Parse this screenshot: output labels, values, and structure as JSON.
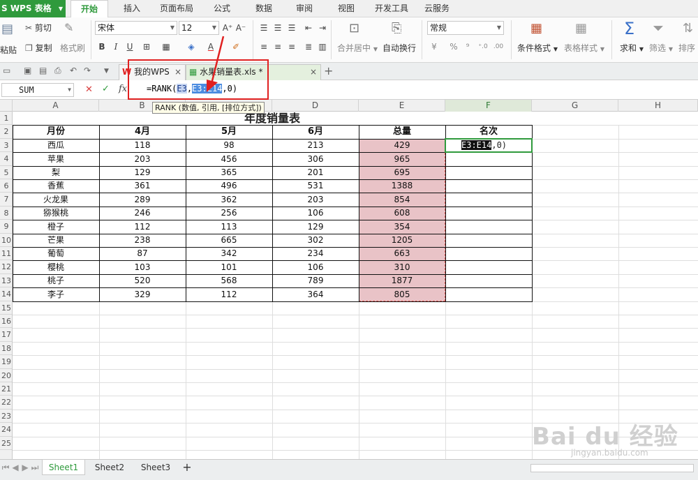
{
  "app": {
    "title": "S WPS 表格",
    "accent": "#2f9a3c"
  },
  "menu": {
    "tabs": [
      "开始",
      "插入",
      "页面布局",
      "公式",
      "数据",
      "审阅",
      "视图",
      "开发工具",
      "云服务"
    ],
    "active": 0
  },
  "ribbon": {
    "paste_label": "粘贴",
    "cut_label": "剪切",
    "copy_label": "复制",
    "format_painter_label": "格式刷",
    "font_name": "宋体",
    "font_size": "12",
    "merge_center_label": "合并居中",
    "wrap_text_label": "自动换行",
    "number_format": "常规",
    "conditional_format_label": "条件格式",
    "table_style_label": "表格样式",
    "sum_label": "求和",
    "filter_label": "筛选",
    "sort_label": "排序",
    "icons": [
      "paste-icon",
      "cut-icon",
      "copy-icon",
      "brush-icon",
      "bold-icon",
      "italic-icon",
      "underline-icon",
      "border-icon",
      "fill-color-icon",
      "font-color-icon",
      "merge-icon",
      "wrap-icon",
      "percent-icon",
      "sigma-icon",
      "funnel-icon"
    ]
  },
  "doc_tabs": [
    {
      "label": "我的WPS",
      "close": "×"
    },
    {
      "label": "水果销量表.xls *",
      "close": "×"
    }
  ],
  "add_tab": "+",
  "formula_bar": {
    "name_box": "SUM",
    "fx": "fx",
    "formula_prefix": "=RANK(",
    "formula_ref1": "E3",
    "formula_sep": ",",
    "formula_ref2": "E3:E14",
    "formula_suffix": ",0)",
    "tooltip": "RANK (数值, 引用, [排位方式])"
  },
  "columns": [
    "A",
    "B",
    "C",
    "D",
    "E",
    "F",
    "G",
    "H"
  ],
  "selected_column": "F",
  "rows": [
    "1",
    "2",
    "3",
    "4",
    "5",
    "6",
    "7",
    "8",
    "9",
    "10",
    "11",
    "12",
    "13",
    "14",
    "15",
    "16",
    "17",
    "18",
    "19",
    "20",
    "21",
    "22",
    "23",
    "24",
    "25"
  ],
  "sheet": {
    "title": "年度销量表",
    "headers": [
      "月份",
      "4月",
      "5月",
      "6月",
      "总量",
      "名次"
    ],
    "data": [
      [
        "西瓜",
        "118",
        "98",
        "213",
        "429"
      ],
      [
        "苹果",
        "203",
        "456",
        "306",
        "965"
      ],
      [
        "梨",
        "129",
        "365",
        "201",
        "695"
      ],
      [
        "香蕉",
        "361",
        "496",
        "531",
        "1388"
      ],
      [
        "火龙果",
        "289",
        "362",
        "203",
        "854"
      ],
      [
        "猕猴桃",
        "246",
        "256",
        "106",
        "608"
      ],
      [
        "橙子",
        "112",
        "113",
        "129",
        "354"
      ],
      [
        "芒果",
        "238",
        "665",
        "302",
        "1205"
      ],
      [
        "葡萄",
        "87",
        "342",
        "234",
        "663"
      ],
      [
        "樱桃",
        "103",
        "101",
        "106",
        "310"
      ],
      [
        "桃子",
        "520",
        "568",
        "789",
        "1877"
      ],
      [
        "李子",
        "329",
        "112",
        "364",
        "805"
      ]
    ],
    "active_cell_ref": "E3:E14",
    "active_cell_suffix": ",0)",
    "range_color": "#e9c3c7"
  },
  "sheet_tabs": [
    "Sheet1",
    "Sheet2",
    "Sheet3"
  ],
  "active_sheet": 0,
  "add_sheet": "+",
  "watermark": {
    "text": "Bai du 经验",
    "sub": "jingyan.baidu.com"
  }
}
